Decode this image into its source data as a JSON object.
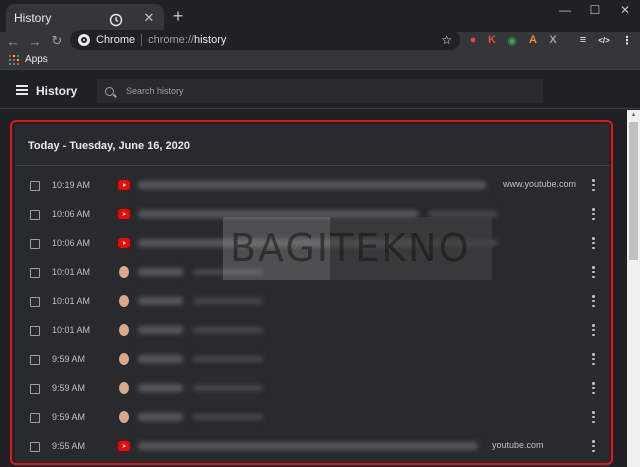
{
  "browser": {
    "tab_title": "History",
    "tab_close": "✕",
    "new_tab": "+",
    "win_min": "—",
    "win_max": "☐",
    "win_close": "✕",
    "back": "←",
    "forward": "→",
    "reload": "↻",
    "omnibox_chip": "Chrome",
    "url_scheme": "chrome://",
    "url_path": "history",
    "star": "☆",
    "bookmarks_apps": "Apps",
    "extensions": [
      {
        "icon": "shield-extension-icon",
        "glyph": "●",
        "color": "#e8453c"
      },
      {
        "icon": "k-extension-icon",
        "glyph": "K",
        "color": "#e8453c"
      },
      {
        "icon": "globe-extension-icon",
        "glyph": "◉",
        "color": "#34a853"
      },
      {
        "icon": "a-extension-icon",
        "glyph": "A",
        "color": "#f28b24"
      },
      {
        "icon": "x-extension-icon",
        "glyph": "X",
        "color": "#9aa0a6"
      },
      {
        "icon": "playlist-icon",
        "glyph": "≡",
        "color": "#e8eaed"
      },
      {
        "icon": "code-extension-icon",
        "glyph": "</>",
        "color": "#e8eaed"
      },
      {
        "icon": "kebab-menu-icon",
        "glyph": "⋮",
        "color": "#e8eaed"
      }
    ]
  },
  "history": {
    "title": "History",
    "search_placeholder": "Search history",
    "date_heading": "Today - Tuesday, June 16, 2020",
    "rows": [
      {
        "time": "10:19 AM",
        "favicon": "youtube",
        "domain": "www.youtube.com"
      },
      {
        "time": "10:06 AM",
        "favicon": "youtube",
        "domain": ""
      },
      {
        "time": "10:06 AM",
        "favicon": "youtube",
        "domain": ""
      },
      {
        "time": "10:01 AM",
        "favicon": "avatar",
        "domain": ""
      },
      {
        "time": "10:01 AM",
        "favicon": "avatar",
        "domain": ""
      },
      {
        "time": "10:01 AM",
        "favicon": "avatar",
        "domain": ""
      },
      {
        "time": "9:59 AM",
        "favicon": "avatar",
        "domain": ""
      },
      {
        "time": "9:59 AM",
        "favicon": "avatar",
        "domain": ""
      },
      {
        "time": "9:59 AM",
        "favicon": "avatar",
        "domain": ""
      },
      {
        "time": "9:55 AM",
        "favicon": "youtube",
        "domain": "youtube.com"
      }
    ]
  },
  "watermark": {
    "left": "BAGI",
    "right": "TEKNO"
  },
  "colors": {
    "highlight": "#e4161b",
    "youtube": "#ff0000"
  }
}
